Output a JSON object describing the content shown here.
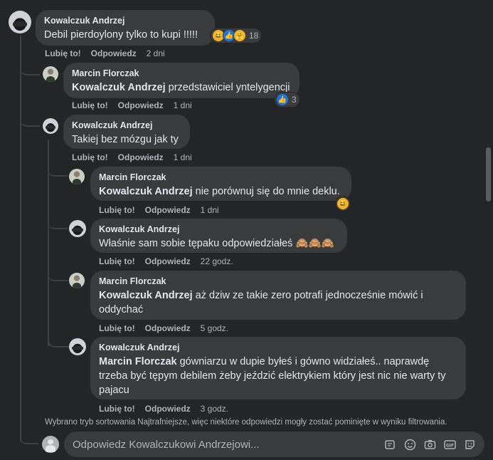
{
  "comments": [
    {
      "author": "Kowalczuk Andrzej",
      "mention": "",
      "text": "Debil pierdoylony tylko to kupi !!!!!",
      "like": "Lubię to!",
      "reply": "Odpowiedz",
      "time": "2 dni",
      "reactions": {
        "icons": [
          "haha-icon",
          "like-icon",
          "care-icon"
        ],
        "count": "18"
      }
    },
    {
      "author": "Marcin Florczak",
      "mention": "Kowalczuk Andrzej",
      "text": " przedstawiciel yntelygencji",
      "like": "Lubię to!",
      "reply": "Odpowiedz",
      "time": "1 dni",
      "reactions": {
        "icons": [
          "like-icon"
        ],
        "count": "3"
      }
    },
    {
      "author": "Kowalczuk Andrzej",
      "mention": "",
      "text": "Takiej bez mózgu jak ty",
      "like": "Lubię to!",
      "reply": "Odpowiedz",
      "time": "1 dni"
    },
    {
      "author": "Marcin Florczak",
      "mention": "Kowalczuk Andrzej",
      "text": " nie porównuj się do mnie deklu.",
      "like": "Lubię to!",
      "reply": "Odpowiedz",
      "time": "1 dni",
      "reactions": {
        "icons": [
          "haha-icon"
        ],
        "count": ""
      }
    },
    {
      "author": "Kowalczuk Andrzej",
      "mention": "",
      "text": "Właśnie sam sobie tępaku odpowiedziałeś 🙈🙈🙈",
      "like": "Lubię to!",
      "reply": "Odpowiedz",
      "time": "22 godz."
    },
    {
      "author": "Marcin Florczak",
      "mention": "Kowalczuk Andrzej",
      "text": " aż dziw ze takie zero potrafi jednocześnie mówić i oddychać",
      "like": "Lubię to!",
      "reply": "Odpowiedz",
      "time": "5 godz."
    },
    {
      "author": "Kowalczuk Andrzej",
      "mention": "Marcin Florczak",
      "text": " gówniarzu w dupie byłeś i gówno widziałeś.. naprawdę trzeba być tępym debilem żeby jeździć elektrykiem który jest nic nie warty ty pajacu",
      "like": "Lubię to!",
      "reply": "Odpowiedz",
      "time": "3 godz."
    }
  ],
  "notice": "Wybrano tryb sortowania Najtrafniejsze, więc niektóre odpowiedzi mogły zostać pominięte w wyniku filtrowania.",
  "composer": {
    "placeholder": "Odpowiedz Kowalczukowi Andrzejowi...",
    "icons": [
      "sticker-icon",
      "emoji-icon",
      "camera-icon",
      "gif-icon",
      "avatar-sticker-icon"
    ]
  }
}
